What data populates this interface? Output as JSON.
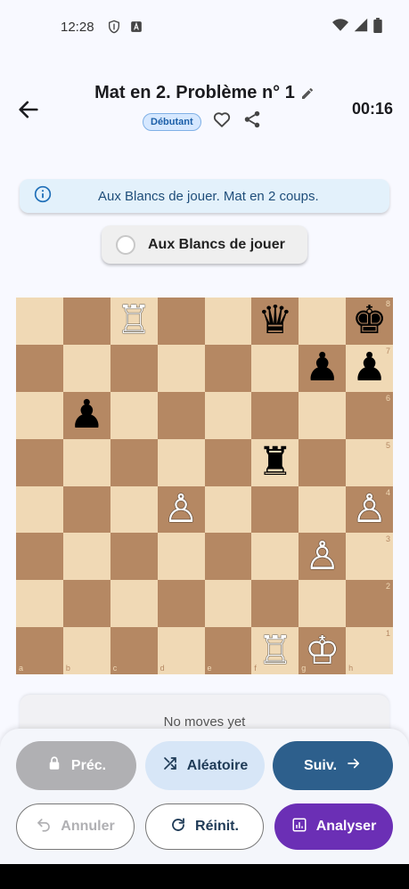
{
  "status_bar": {
    "time": "12:28",
    "icons": [
      "shield-icon",
      "a-badge-icon",
      "wifi-icon",
      "cell-signal-icon",
      "battery-icon"
    ]
  },
  "header": {
    "title": "Mat en 2. Problème n° 1",
    "level_badge": "Débutant",
    "timer": "00:16"
  },
  "info_banner": {
    "text": "Aux Blancs de jouer. Mat en 2 coups."
  },
  "turn_toggle": {
    "label": "Aux Blancs de jouer"
  },
  "board": {
    "files": [
      "a",
      "b",
      "c",
      "d",
      "e",
      "f",
      "g",
      "h"
    ],
    "ranks": [
      "8",
      "7",
      "6",
      "5",
      "4",
      "3",
      "2",
      "1"
    ],
    "rows": [
      [
        "",
        "",
        "wR",
        "",
        "",
        "bQ",
        "",
        "bK"
      ],
      [
        "",
        "",
        "",
        "",
        "",
        "",
        "bP",
        "bP"
      ],
      [
        "",
        "bP",
        "",
        "",
        "",
        "",
        "",
        ""
      ],
      [
        "",
        "",
        "",
        "",
        "",
        "bR",
        "",
        ""
      ],
      [
        "",
        "",
        "",
        "wP",
        "",
        "",
        "",
        "wP"
      ],
      [
        "",
        "",
        "",
        "",
        "",
        "",
        "wP",
        ""
      ],
      [
        "",
        "",
        "",
        "",
        "",
        "",
        "",
        ""
      ],
      [
        "",
        "",
        "",
        "",
        "",
        "wR",
        "wK",
        ""
      ]
    ],
    "glyphs": {
      "wK": "♔",
      "wQ": "♕",
      "wR": "♖",
      "wB": "♗",
      "wN": "♘",
      "wP": "♙",
      "bK": "♚",
      "bQ": "♛",
      "bR": "♜",
      "bB": "♝",
      "bN": "♞",
      "bP": "♟"
    },
    "colors": {
      "light": "#f0d9b5",
      "dark": "#b58863"
    }
  },
  "moves": {
    "empty_text": "No moves yet"
  },
  "controls": {
    "prev": "Préc.",
    "random": "Aléatoire",
    "next": "Suiv.",
    "undo": "Annuler",
    "reset": "Réinit.",
    "analyse": "Analyser"
  },
  "colors": {
    "accent": "#2d5f8c",
    "analyse": "#6b2fb5",
    "badge_text": "#1c5fa8",
    "banner_bg": "#e3f1fb"
  }
}
